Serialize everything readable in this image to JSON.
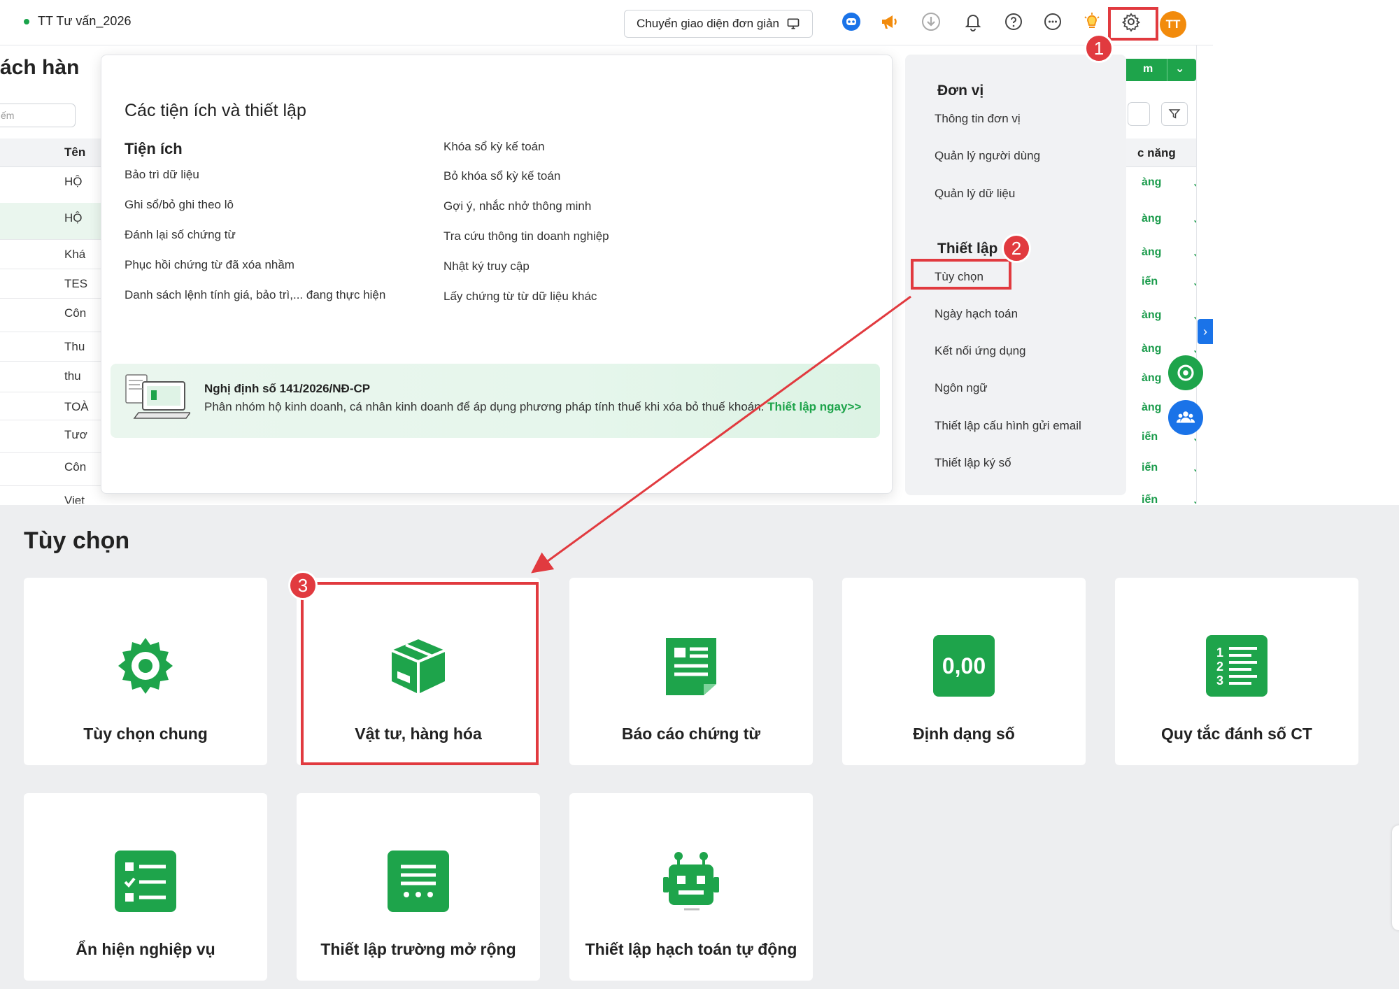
{
  "topbar": {
    "company": "TT Tư vấn_2026",
    "simple_view_label": "Chuyển giao diện đơn giản",
    "avatar_initials": "TT",
    "icons": [
      "robot-icon",
      "megaphone-icon",
      "download-icon",
      "bell-icon",
      "help-icon",
      "chat-icon",
      "bulb-icon",
      "gear-icon"
    ]
  },
  "background_list": {
    "title_fragment": "ách hàn",
    "search_placeholder": "ếm",
    "column_header": "Tên",
    "rows": [
      "HỘ",
      "HỘ",
      "Khá",
      "TES",
      "Côn",
      "Thu",
      "thu",
      "TOÀ",
      "Tươ",
      "Côn",
      "Viet"
    ],
    "right_header": "c năng",
    "right_rows": [
      "àng",
      "àng",
      "àng",
      "iến",
      "àng",
      "àng",
      "àng",
      "àng",
      "iến",
      "iến",
      "iến"
    ],
    "button_fragment": "m"
  },
  "menu": {
    "heading": "Các tiện ích và thiết lập",
    "utilities_title": "Tiện ích",
    "utilities_col1": [
      "Bảo trì dữ liệu",
      "Ghi sổ/bỏ ghi theo lô",
      "Đánh lại số chứng từ",
      "Phục hồi chứng từ đã xóa nhầm",
      "Danh sách lệnh tính giá, bảo trì,... đang thực hiện"
    ],
    "utilities_col2": [
      "Khóa sổ kỳ kế toán",
      "Bỏ khóa sổ kỳ kế toán",
      "Gợi ý, nhắc nhở thông minh",
      "Tra cứu thông tin doanh nghiệp",
      "Nhật ký truy cập",
      "Lấy chứng từ từ dữ liệu khác"
    ],
    "banner_title": "Nghị định số 141/2026/NĐ-CP",
    "banner_text": "Phân nhóm hộ kinh doanh, cá nhân kinh doanh để áp dụng phương pháp tính thuế khi xóa bỏ thuế khoán.",
    "banner_link": "Thiết lập ngay>>",
    "unit_title": "Đơn vị",
    "unit_items": [
      "Thông tin đơn vị",
      "Quản lý người dùng",
      "Quản lý dữ liệu"
    ],
    "setup_title": "Thiết lập",
    "setup_items": [
      "Tùy chọn",
      "Ngày hạch toán",
      "Kết nối ứng dụng",
      "Ngôn ngữ",
      "Thiết lập cấu hình gửi email",
      "Thiết lập ký số"
    ]
  },
  "steps": [
    "1",
    "2",
    "3"
  ],
  "options": {
    "title": "Tùy chọn",
    "cards": [
      {
        "label": "Tùy chọn chung",
        "icon": "gear-icon"
      },
      {
        "label": "Vật tư, hàng hóa",
        "icon": "box-icon"
      },
      {
        "label": "Báo cáo chứng từ",
        "icon": "document-icon"
      },
      {
        "label": "Định dạng số",
        "icon": "number-format-icon",
        "icon_text": "0,00"
      },
      {
        "label": "Quy tắc đánh số CT",
        "icon": "numbered-list-icon"
      },
      {
        "label": "Ẩn hiện nghiệp vụ",
        "icon": "checklist-icon"
      },
      {
        "label": "Thiết lập trường mở rộng",
        "icon": "extended-fields-icon"
      },
      {
        "label": "Thiết lập hạch toán tự động",
        "icon": "robot-icon"
      }
    ]
  },
  "colors": {
    "accent": "#1ea44b",
    "highlight": "#e13a3f",
    "avatar": "#f28b0c",
    "link": "#1a73e8"
  }
}
